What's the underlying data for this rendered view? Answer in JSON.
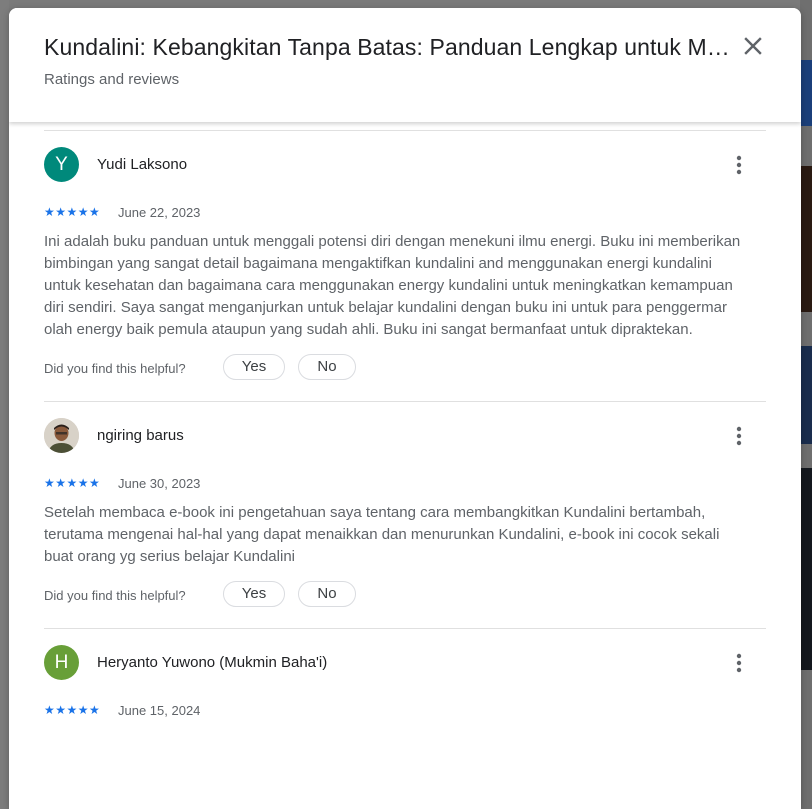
{
  "dialog": {
    "title": "Kundalini: Kebangkitan Tanpa Batas: Panduan Lengkap untuk Membangkitkan Energi Kundalini",
    "subtitle": "Ratings and reviews"
  },
  "helpful_prompt": "Did you find this helpful?",
  "yes_label": "Yes",
  "no_label": "No",
  "star_glyphs": "★★★★★",
  "colors": {
    "star": "#1a73e8",
    "avatar_teal": "#00897b",
    "avatar_green": "#689f38"
  },
  "reviews": [
    {
      "initial": "Y",
      "name": "Yudi Laksono",
      "rating": 5,
      "date": "June 22, 2023",
      "text": "Ini adalah buku panduan untuk menggali potensi diri dengan menekuni ilmu energi. Buku ini memberikan bimbingan yang sangat detail bagaimana mengaktifkan kundalini and menggunakan energi kundalini untuk kesehatan dan bagaimana cara menggunakan energy kundalini untuk meningkatkan kemampuan diri sendiri. Saya sangat menganjurkan untuk belajar kundalini dengan buku ini untuk para penggermar olah energy baik pemula ataupun yang sudah ahli. Buku ini sangat bermanfaat untuk dipraktekan."
    },
    {
      "initial": "",
      "name": "ngiring barus",
      "rating": 5,
      "date": "June 30, 2023",
      "text": "Setelah membaca e-book ini pengetahuan saya tentang cara membangkitkan Kundalini bertambah, terutama mengenai hal-hal yang dapat menaikkan dan menurunkan Kundalini, e-book ini cocok sekali buat orang yg serius belajar Kundalini"
    },
    {
      "initial": "H",
      "name": "Heryanto Yuwono (Mukmin Baha'i)",
      "rating": 5,
      "date": "June 15, 2024",
      "text": ""
    }
  ]
}
